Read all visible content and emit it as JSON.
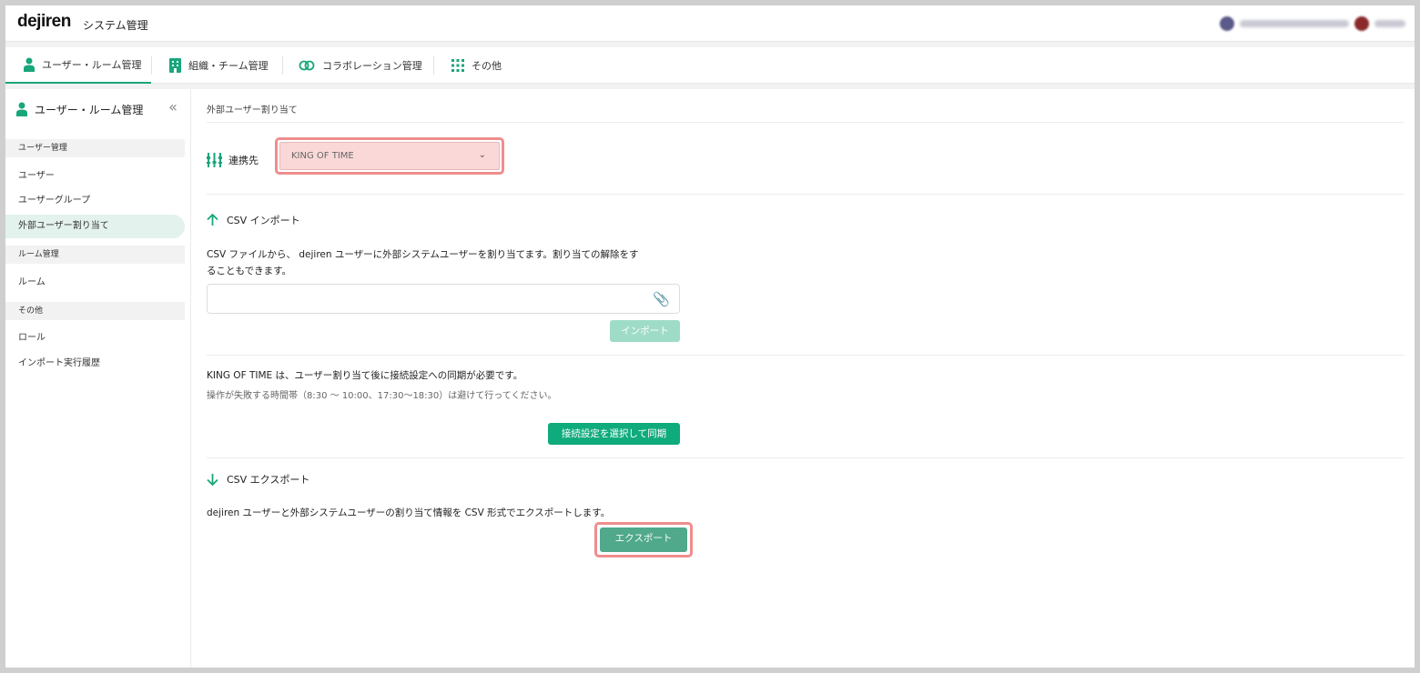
{
  "header": {
    "logo": "dejiren",
    "app_title": "システム管理"
  },
  "nav": {
    "tabs": [
      {
        "label": "ユーザー・ルーム管理",
        "icon": "person-icon",
        "active": true
      },
      {
        "label": "組織・チーム管理",
        "icon": "building-icon",
        "active": false
      },
      {
        "label": "コラボレーション管理",
        "icon": "link-icon",
        "active": false
      },
      {
        "label": "その他",
        "icon": "grid-icon",
        "active": false
      }
    ]
  },
  "sidebar": {
    "title": "ユーザー・ルーム管理",
    "collapse_symbol": "«",
    "sections": [
      {
        "label": "ユーザー管理",
        "items": [
          "ユーザー",
          "ユーザーグループ",
          "外部ユーザー割り当て"
        ]
      },
      {
        "label": "ルーム管理",
        "items": [
          "ルーム"
        ]
      },
      {
        "label": "その他",
        "items": [
          "ロール",
          "インポート実行履歴"
        ]
      }
    ],
    "active_item": "外部ユーザー割り当て"
  },
  "main": {
    "breadcrumb": "外部ユーザー割り当て",
    "connection": {
      "label": "連携先",
      "selected": "KING OF TIME"
    },
    "csv_import": {
      "title": "CSV インポート",
      "description_line1": "CSV ファイルから、 dejiren ユーザーに外部システムユーザーを割り当てます。割り当ての解除をす",
      "description_line2": "ることもできます。",
      "file_placeholder": "",
      "button": "インポート"
    },
    "sync": {
      "note": "KING OF TIME は、ユーザー割り当て後に接続設定への同期が必要です。",
      "warning": "操作が失敗する時間帯（8:30 ～ 10:00、17:30～18:30）は避けて行ってください。",
      "button": "接続設定を選択して同期"
    },
    "csv_export": {
      "title": "CSV エクスポート",
      "description": "dejiren ユーザーと外部システムユーザーの割り当て情報を CSV 形式でエクスポートします。",
      "button": "エクスポート"
    }
  },
  "colors": {
    "accent": "#19a67b",
    "highlight_border": "#ef8d8d"
  }
}
